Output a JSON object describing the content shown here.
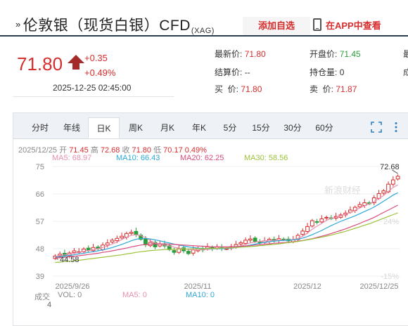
{
  "header": {
    "title": "伦敦银（现货白银）CFD",
    "title_suffix": "(XAG)",
    "add_watchlist": "添加自选",
    "view_in_app": "在APP中查看"
  },
  "price_box": {
    "price": "71.80",
    "change": "+0.35",
    "change_pct": "+0.49%",
    "datetime": "2025-12-25 02:45:00"
  },
  "quote": {
    "latest_label": "最新价:",
    "latest_value": "71.80",
    "settle_label": "结算价:",
    "settle_value": "--",
    "bid_label": "买  价:",
    "bid_value": "71.80",
    "open_label": "开盘价:",
    "open_value": "71.45",
    "position_label": "持仓量:",
    "position_value": "0",
    "ask_label": "卖  价:",
    "ask_value": "71.87",
    "col3_row1": "最",
    "col3_row2": "成"
  },
  "tabs": [
    "分时",
    "年线",
    "日K",
    "周K",
    "月K",
    "年K",
    "5分",
    "15分",
    "30分",
    "60分"
  ],
  "active_tab": "日K",
  "chart_info": {
    "date": "2025/12/25",
    "open_label": "开",
    "open": "71.45",
    "high_label": "高",
    "high": "72.68",
    "close_label": "收",
    "close": "71.80",
    "low_label": "低",
    "low": "70.17",
    "pct": "0.49%"
  },
  "ma": {
    "ma5": "MA5: 68.97",
    "ma10": "MA10: 66.43",
    "ma20": "MA20: 62.25",
    "ma30": "MA30: 58.56"
  },
  "colors": {
    "up": "#d62d2d",
    "down": "#2a9d3c",
    "ma5": "#e88fb0",
    "ma10": "#2ea8d8",
    "ma20": "#d94b7c",
    "ma30": "#9cc23c"
  },
  "watermark": "新浪财经",
  "vol": {
    "label": "成交",
    "vol_text": "VOL: 0",
    "ma5_text": "MA5: 0",
    "ma10_text": "MA10: 0",
    "axis_value": "4"
  },
  "chart_data": {
    "type": "candlestick",
    "title": "",
    "y_ticks": [
      "75",
      "66",
      "57",
      "48",
      "39"
    ],
    "ylim": [
      39,
      75
    ],
    "right_ticks": [
      "24%",
      "-15%"
    ],
    "x_ticks": [
      "2025/9/26",
      "2025/11",
      "2025/12",
      "2025/12/25"
    ],
    "max_label": "72.68",
    "min_label": "44.58",
    "series_close": [
      45.6,
      46.2,
      45.8,
      46.6,
      47.3,
      47.0,
      47.9,
      47.5,
      48.4,
      48.0,
      49.2,
      49.9,
      50.8,
      51.4,
      52.1,
      53.0,
      53.4,
      52.6,
      51.1,
      49.3,
      50.1,
      48.6,
      49.6,
      48.9,
      47.7,
      46.8,
      48.0,
      47.3,
      46.4,
      47.6,
      48.1,
      47.6,
      48.6,
      48.0,
      48.6,
      48.0,
      48.0,
      48.7,
      49.4,
      50.0,
      50.8,
      51.2,
      50.4,
      49.9,
      50.6,
      51.1,
      50.5,
      51.3,
      51.0,
      50.6,
      51.0,
      52.4,
      53.8,
      55.3,
      57.2,
      56.8,
      57.8,
      58.3,
      57.9,
      58.6,
      59.1,
      59.7,
      60.7,
      61.6,
      62.5,
      63.1,
      62.8,
      64.7,
      66.1,
      67.0,
      69.2,
      70.6,
      71.8
    ],
    "ma5": [
      45.4,
      45.8,
      46.0,
      46.2,
      46.5,
      46.8,
      47.1,
      47.4,
      47.7,
      48.0,
      48.4,
      48.9,
      49.5,
      50.2,
      51.0,
      51.8,
      52.4,
      52.6,
      52.3,
      51.7,
      50.6,
      49.9,
      49.5,
      49.2,
      48.9,
      48.5,
      48.2,
      47.9,
      47.8,
      47.6,
      47.6,
      47.7,
      47.8,
      47.9,
      48.1,
      48.2,
      48.3,
      48.4,
      48.6,
      48.9,
      49.4,
      49.9,
      50.2,
      50.4,
      50.6,
      50.7,
      50.8,
      50.8,
      50.8,
      50.9,
      51.0,
      51.4,
      52.1,
      53.1,
      54.4,
      55.4,
      56.3,
      57.3,
      58.0,
      58.4,
      58.8,
      59.3,
      59.9,
      60.6,
      61.4,
      62.1,
      62.8,
      63.5,
      64.4,
      65.5,
      66.8,
      68.1,
      69.0
    ],
    "ma10": [
      45.2,
      45.4,
      45.6,
      45.8,
      46.0,
      46.3,
      46.5,
      46.8,
      47.0,
      47.3,
      47.6,
      48.0,
      48.4,
      48.9,
      49.4,
      50.0,
      50.6,
      51.1,
      51.4,
      51.4,
      51.2,
      50.9,
      50.6,
      50.2,
      49.9,
      49.5,
      49.2,
      48.9,
      48.6,
      48.4,
      48.2,
      48.1,
      48.0,
      48.0,
      48.0,
      48.0,
      48.1,
      48.2,
      48.4,
      48.6,
      48.9,
      49.2,
      49.5,
      49.8,
      50.1,
      50.3,
      50.5,
      50.6,
      50.7,
      50.8,
      50.9,
      51.1,
      51.5,
      52.0,
      52.6,
      53.3,
      54.0,
      54.8,
      55.6,
      56.3,
      57.0,
      57.6,
      58.2,
      58.8,
      59.5,
      60.2,
      60.9,
      61.7,
      62.6,
      63.6,
      64.6,
      65.6,
      66.4
    ],
    "ma20": [
      45.0,
      45.1,
      45.2,
      45.4,
      45.5,
      45.7,
      45.9,
      46.1,
      46.3,
      46.5,
      46.8,
      47.0,
      47.3,
      47.6,
      47.9,
      48.2,
      48.6,
      48.9,
      49.2,
      49.4,
      49.5,
      49.6,
      49.6,
      49.6,
      49.5,
      49.4,
      49.3,
      49.2,
      49.1,
      49.0,
      48.9,
      48.8,
      48.7,
      48.6,
      48.6,
      48.6,
      48.6,
      48.6,
      48.7,
      48.8,
      48.9,
      49.0,
      49.2,
      49.3,
      49.5,
      49.6,
      49.8,
      49.9,
      50.0,
      50.1,
      50.3,
      50.5,
      50.7,
      51.0,
      51.3,
      51.7,
      52.1,
      52.5,
      53.0,
      53.5,
      54.0,
      54.5,
      55.1,
      55.7,
      56.3,
      57.0,
      57.6,
      58.3,
      59.1,
      59.9,
      60.7,
      61.5,
      62.3
    ],
    "ma30": [
      43.5,
      43.6,
      43.8,
      43.9,
      44.1,
      44.2,
      44.4,
      44.6,
      44.8,
      45.0,
      45.2,
      45.4,
      45.6,
      45.8,
      46.0,
      46.3,
      46.5,
      46.8,
      47.0,
      47.2,
      47.4,
      47.5,
      47.6,
      47.7,
      47.8,
      47.8,
      47.9,
      47.9,
      47.9,
      48.0,
      48.0,
      48.0,
      48.1,
      48.1,
      48.1,
      48.2,
      48.2,
      48.3,
      48.4,
      48.5,
      48.6,
      48.7,
      48.8,
      49.0,
      49.1,
      49.3,
      49.4,
      49.6,
      49.8,
      50.0,
      50.2,
      50.4,
      50.6,
      50.9,
      51.2,
      51.5,
      51.8,
      52.1,
      52.5,
      52.9,
      53.3,
      53.7,
      54.2,
      54.7,
      55.2,
      55.7,
      56.2,
      56.8,
      57.4,
      58.0,
      58.6,
      59.2,
      59.8
    ]
  }
}
